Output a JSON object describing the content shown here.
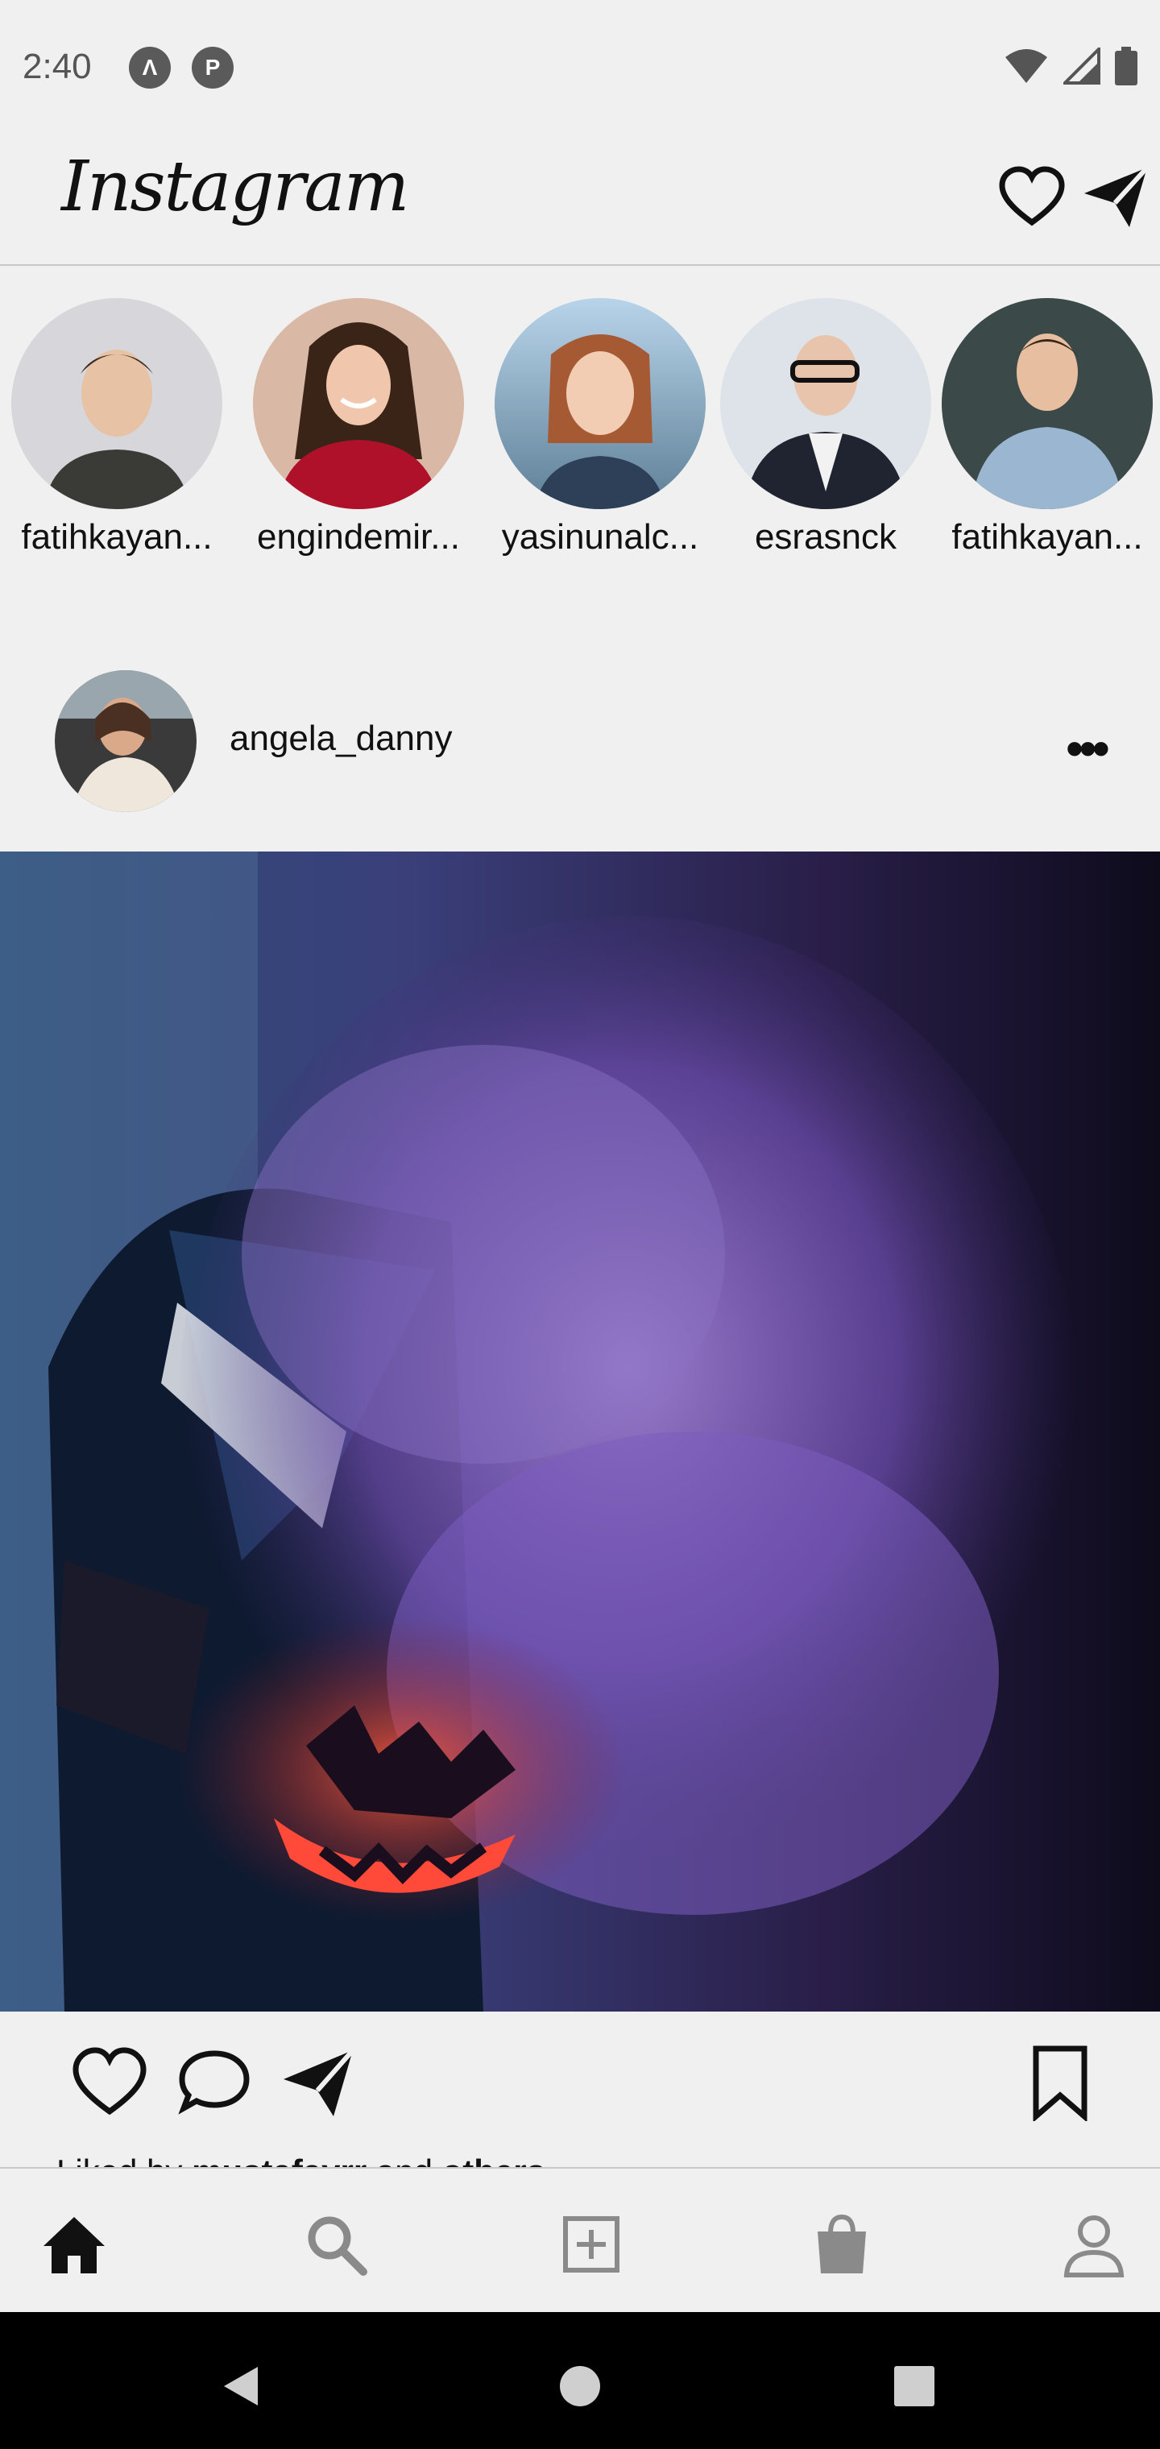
{
  "status_bar": {
    "time": "2:40",
    "left_icons": [
      "app-a-icon",
      "app-p-icon"
    ],
    "right_icons": [
      "wifi-icon",
      "cell-signal-icon",
      "battery-icon"
    ]
  },
  "header": {
    "logo": "Instagram",
    "icons": [
      "heart-icon",
      "send-icon"
    ]
  },
  "stories": [
    {
      "username": "fatihkayan..."
    },
    {
      "username": "engindemir..."
    },
    {
      "username": "yasinunalc..."
    },
    {
      "username": "esrasnck"
    },
    {
      "username": "fatihkayan..."
    }
  ],
  "post": {
    "username": "angela_danny",
    "more_label": "•••",
    "liked_by_prefix": "Liked by ",
    "liked_by_user": "mustafayrr",
    "liked_by_mid": " and ",
    "liked_by_suffix": "others"
  },
  "bottom_nav": [
    "home-icon",
    "search-icon",
    "add-post-icon",
    "shop-icon",
    "profile-icon"
  ],
  "colors": {
    "background": "#f0f0f0",
    "text": "#111111",
    "icon_inactive": "#8a8a8a",
    "android_nav": "#000000"
  }
}
